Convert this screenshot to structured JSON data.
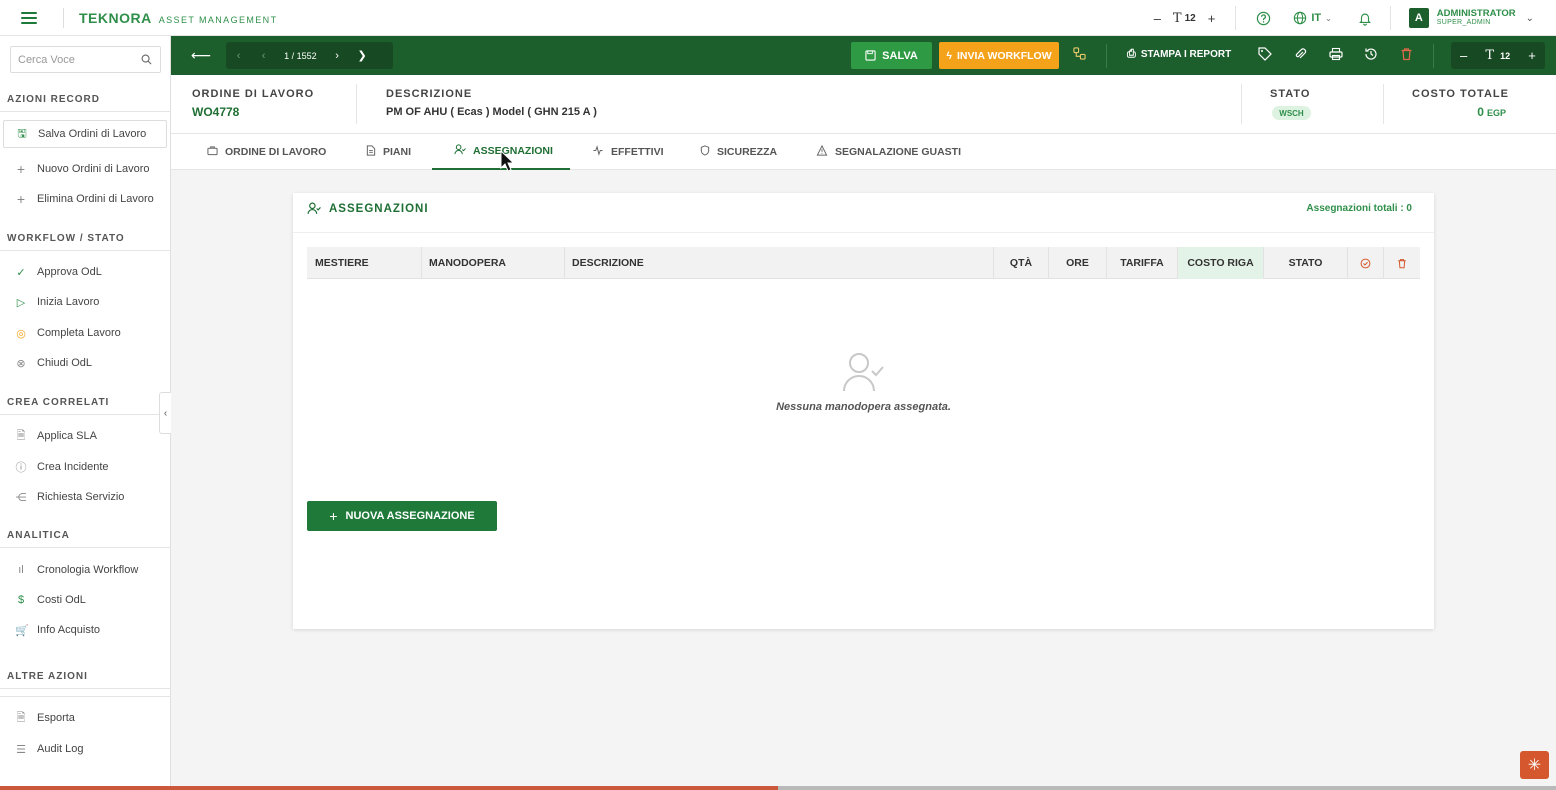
{
  "topbar": {
    "logo_name": "TEKNORA",
    "logo_sub": "ASSET MANAGEMENT",
    "font_minus": "–",
    "font_t": "T",
    "font_size": "12",
    "font_plus": "+",
    "lang": "IT",
    "user_initial": "A",
    "user_name": "ADMINISTRATOR",
    "user_role": "SUPER_ADMIN"
  },
  "sidebar": {
    "search_placeholder": "Cerca Voce",
    "sections": {
      "azioni_record": "AZIONI RECORD",
      "workflow": "WORKFLOW / STATO",
      "correlati": "CREA CORRELATI",
      "analitica": "ANALITICA",
      "altre": "ALTRE AZIONI"
    },
    "items": {
      "salva": "Salva Ordini di Lavoro",
      "nuovo": "Nuovo Ordini di Lavoro",
      "elimina": "Elimina Ordini di Lavoro",
      "approva": "Approva OdL",
      "inizia": "Inizia Lavoro",
      "completa": "Completa Lavoro",
      "chiudi": "Chiudi OdL",
      "sla": "Applica SLA",
      "incidente": "Crea Incidente",
      "servizio": "Richiesta Servizio",
      "cronologia": "Cronologia Workflow",
      "costi": "Costi OdL",
      "acquisto": "Info Acquisto",
      "esporta": "Esporta",
      "audit": "Audit Log"
    }
  },
  "toolbar": {
    "page_current": "1",
    "page_total": "/ 1552",
    "save_label": "SALVA",
    "workflow_label": "INVIA WORKFLOW",
    "print_label": "STAMPA I REPORT",
    "font_size": "12"
  },
  "record": {
    "order_label": "ORDINE DI LAVORO",
    "order_value": "WO4778",
    "desc_label": "DESCRIZIONE",
    "desc_value": "PM OF AHU   ( Ecas )  Model ( GHN 215 A )",
    "status_label": "STATO",
    "status_value": "WSCH",
    "cost_label": "COSTO TOTALE",
    "cost_value": "0",
    "cost_currency": "EGP"
  },
  "tabs": {
    "ordine": "ORDINE DI LAVORO",
    "piani": "PIANI",
    "assegnazioni": "ASSEGNAZIONI",
    "effettivi": "EFFETTIVI",
    "sicurezza": "SICUREZZA",
    "guasti": "SEGNALAZIONE GUASTI"
  },
  "panel": {
    "title": "ASSEGNAZIONI",
    "total": "Assegnazioni totali : 0",
    "columns": [
      "MESTIERE",
      "MANODOPERA",
      "DESCRIZIONE",
      "QTÀ",
      "ORE",
      "TARIFFA",
      "COSTO RIGA",
      "STATO"
    ],
    "empty_text": "Nessuna manodopera assegnata.",
    "new_button": "NUOVA ASSEGNAZIONE"
  },
  "colors": {
    "brand_green": "#1d5e2d",
    "accent_green": "#2f8f4a",
    "workflow_orange": "#f5a21b"
  },
  "progress": 0.5
}
